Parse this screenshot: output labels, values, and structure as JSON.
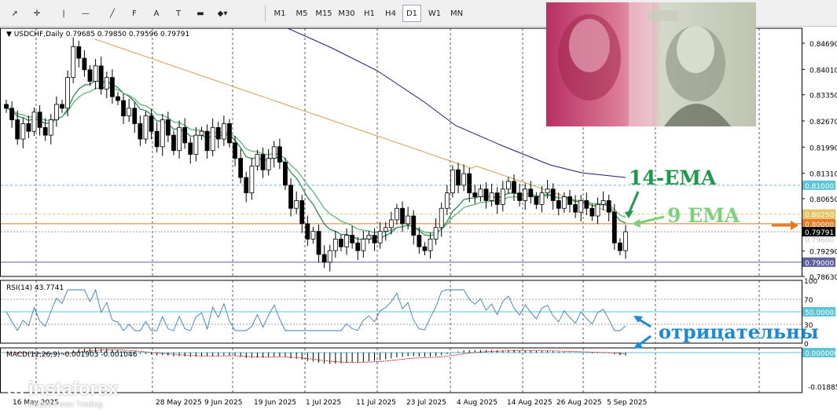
{
  "toolbar": {
    "tools": [
      {
        "name": "cursor-tool",
        "glyph": "➚"
      },
      {
        "name": "crosshair-tool",
        "glyph": "✛"
      },
      {
        "name": "vertical-line-tool",
        "glyph": "|"
      },
      {
        "name": "horizontal-line-tool",
        "glyph": "—"
      },
      {
        "name": "trendline-tool",
        "glyph": "╱"
      },
      {
        "name": "fibonacci-tool",
        "glyph": "F"
      },
      {
        "name": "text-tool",
        "glyph": "A"
      },
      {
        "name": "text-label-tool",
        "glyph": "T"
      },
      {
        "name": "rectangle-tool",
        "glyph": "▬"
      },
      {
        "name": "shapes-tool",
        "glyph": "◆▾"
      }
    ],
    "timeframes": [
      "M1",
      "M5",
      "M15",
      "M30",
      "H1",
      "H4",
      "D1",
      "W1",
      "MN"
    ],
    "active_timeframe": "D1"
  },
  "main_chart": {
    "header": "USDCHF,Daily  0.79685 0.79850 0.79596 0.79791",
    "price_ticks": [
      "0.84690",
      "0.84010",
      "0.83350",
      "0.82670",
      "0.81990",
      "0.81310",
      "0.80650",
      "0.79290",
      "0.78630"
    ],
    "level_labels": [
      {
        "text": "0.81000",
        "bg": "#5bc4d8"
      },
      {
        "text": "0.80250",
        "bg": "#e8c060"
      },
      {
        "text": "0.80000",
        "bg": "#e87820"
      },
      {
        "text": "0.79791",
        "bg": "#000000"
      },
      {
        "text": "0.79000",
        "bg": "#6060a0"
      }
    ],
    "faint_price": "0.79600",
    "date_labels": [
      "16 May 2025",
      "28 May 2025",
      "9 Jun 2025",
      "19 Jun 2025",
      "1 Jul 2025",
      "11 Jul 2025",
      "23 Jul 2025",
      "4 Aug 2025",
      "14 Aug 2025",
      "26 Aug 2025",
      "5 Sep 2025"
    ]
  },
  "rsi": {
    "header": "RSI(14) 43.7741",
    "ticks": [
      "100",
      "70",
      "30",
      "0"
    ],
    "level_label": "50.0000"
  },
  "macd": {
    "header": "MACD(12,26,9) -0.001903 -0.001046",
    "ticks": [
      "-0.018851"
    ],
    "level_label": "0.000000"
  },
  "annotations": {
    "ema14": "14-EMA",
    "ema9": "9 EMA",
    "negative": "отрицательны"
  },
  "branding": {
    "logo": "instaforex",
    "tagline": "Instant Forex Trading"
  },
  "colors": {
    "ema9": "#2e8b57",
    "ema14": "#5cb87a",
    "ema50": "#d4a050",
    "ema200": "#1a1a7a",
    "rsi_line": "#3a7fc0",
    "annotation_green": "#1a9a4a",
    "annotation_light_green": "#7ad27a",
    "annotation_blue": "#1a8ad8",
    "arrow_orange": "#e87820"
  }
}
